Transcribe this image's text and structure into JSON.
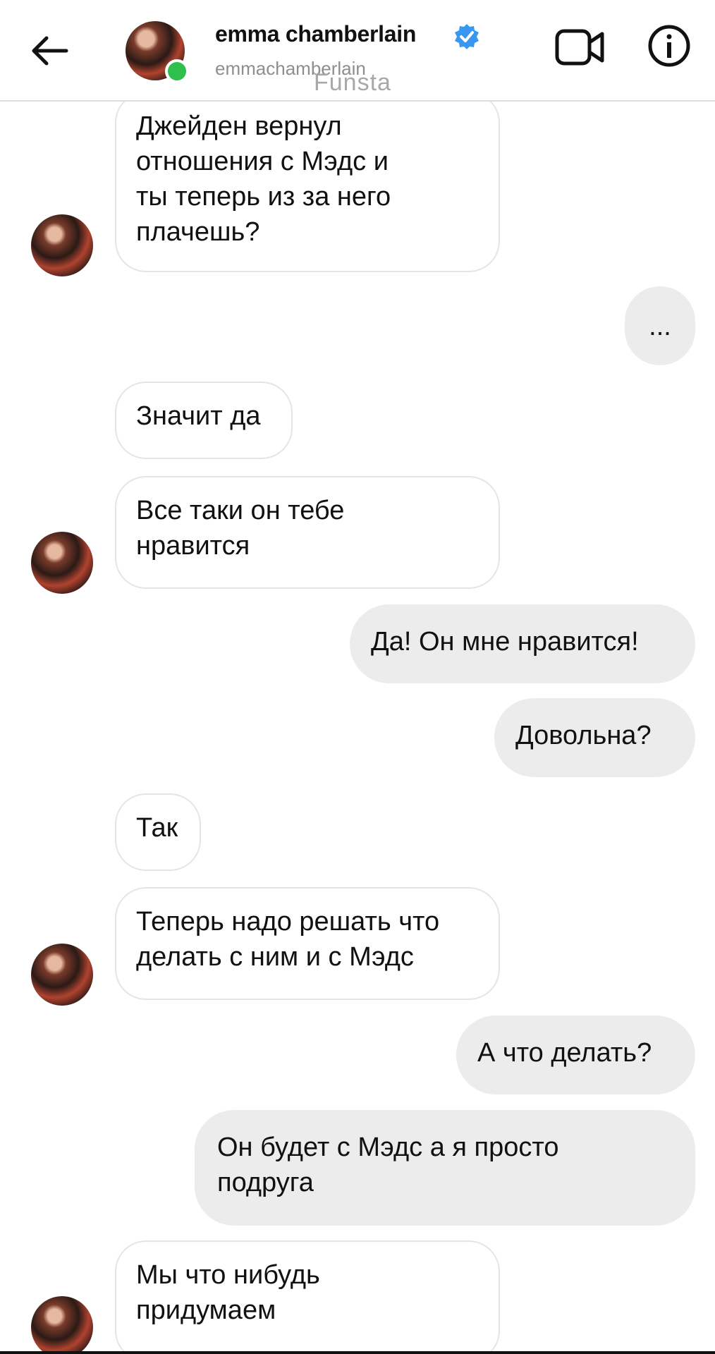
{
  "header": {
    "name": "emma chamberlain",
    "username": "emmachamberlain",
    "watermark": "Funsta"
  },
  "messages": [
    {
      "dir": "in",
      "text": "Джейден вернул\nотношения с Мэдс и\nты теперь из за него\nплачешь?",
      "avatar": true
    },
    {
      "dir": "out",
      "text": "..."
    },
    {
      "dir": "in",
      "text": "Значит да",
      "avatar": false
    },
    {
      "dir": "in",
      "text": "Все таки он тебе\nнравится",
      "avatar": true
    },
    {
      "dir": "out",
      "text": "Да! Он мне нравится!"
    },
    {
      "dir": "out",
      "text": "Довольна?"
    },
    {
      "dir": "in",
      "text": "Так",
      "avatar": false
    },
    {
      "dir": "in",
      "text": "Теперь надо решать что\nделать с ним и с Мэдс",
      "avatar": true
    },
    {
      "dir": "out",
      "text": "А что делать?"
    },
    {
      "dir": "out",
      "text": "Он будет с Мэдс а я просто\nподруга"
    },
    {
      "dir": "in",
      "text": "Мы что нибудь\nпридумаем",
      "avatar": true
    }
  ]
}
